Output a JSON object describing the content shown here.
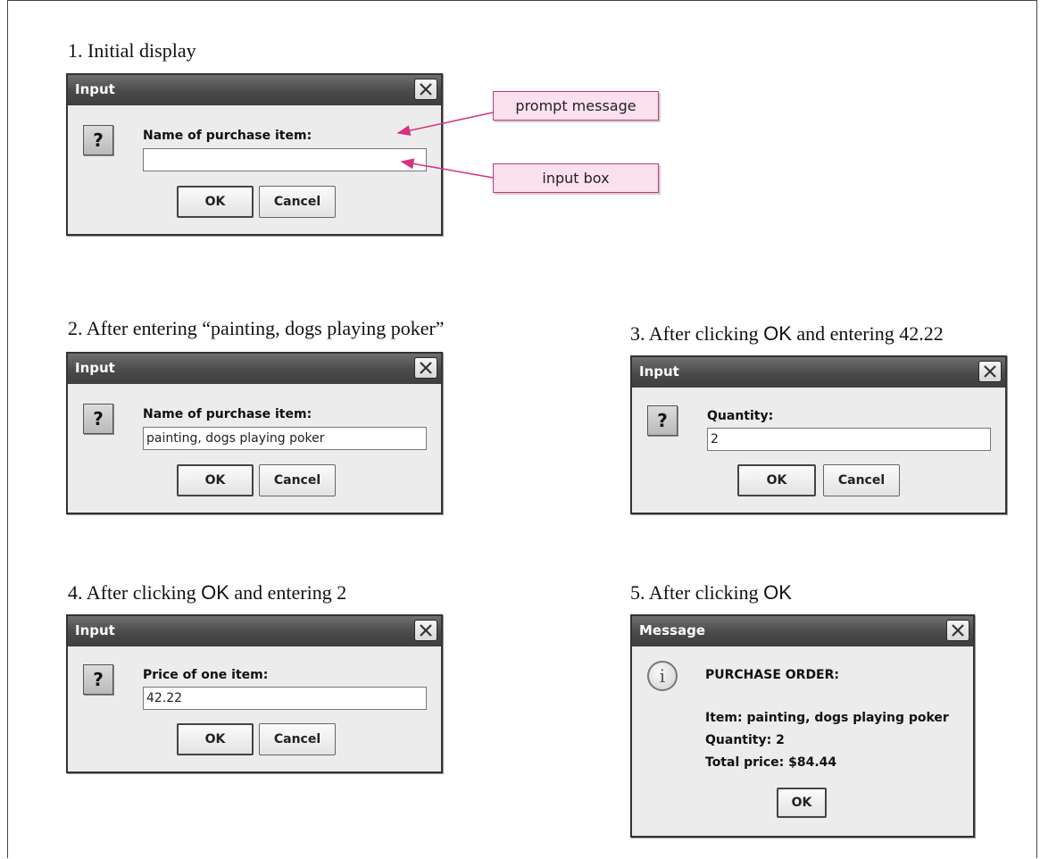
{
  "steps": [
    {
      "caption": "1. Initial display",
      "dialog_title": "Input",
      "prompt": "Name of purchase item:",
      "input_value": ""
    },
    {
      "caption": "2. After entering “painting, dogs playing poker”",
      "dialog_title": "Input",
      "prompt": "Name of purchase item:",
      "input_value": "painting, dogs playing poker"
    },
    {
      "caption_pre": "3. After clicking ",
      "caption_ok": "OK",
      "caption_post": " and entering 42.22",
      "dialog_title": "Input",
      "prompt": "Quantity:",
      "input_value": "2"
    },
    {
      "caption_pre": "4. After clicking ",
      "caption_ok": "OK",
      "caption_post": " and entering 2",
      "dialog_title": "Input",
      "prompt": "Price of one item:",
      "input_value": "42.22"
    },
    {
      "caption_pre": "5. After clicking ",
      "caption_ok": "OK",
      "dialog_title": "Message",
      "heading": "PURCHASE ORDER:",
      "lines": [
        "Item: painting, dogs playing poker",
        "Quantity: 2",
        "Total price: $84.44"
      ]
    }
  ],
  "buttons": {
    "ok": "OK",
    "cancel": "Cancel"
  },
  "icons": {
    "question": "question-icon",
    "info": "info-icon",
    "close": "close-icon"
  },
  "icon_glyphs": {
    "question": "?",
    "info": "i"
  },
  "callouts": {
    "prompt_message": "prompt message",
    "input_box": "input box"
  },
  "colors": {
    "callout_fill": "#fbe0ee",
    "callout_border": "#c8367f",
    "arrow": "#d6307f",
    "titlebar": "#4a4a4a"
  }
}
